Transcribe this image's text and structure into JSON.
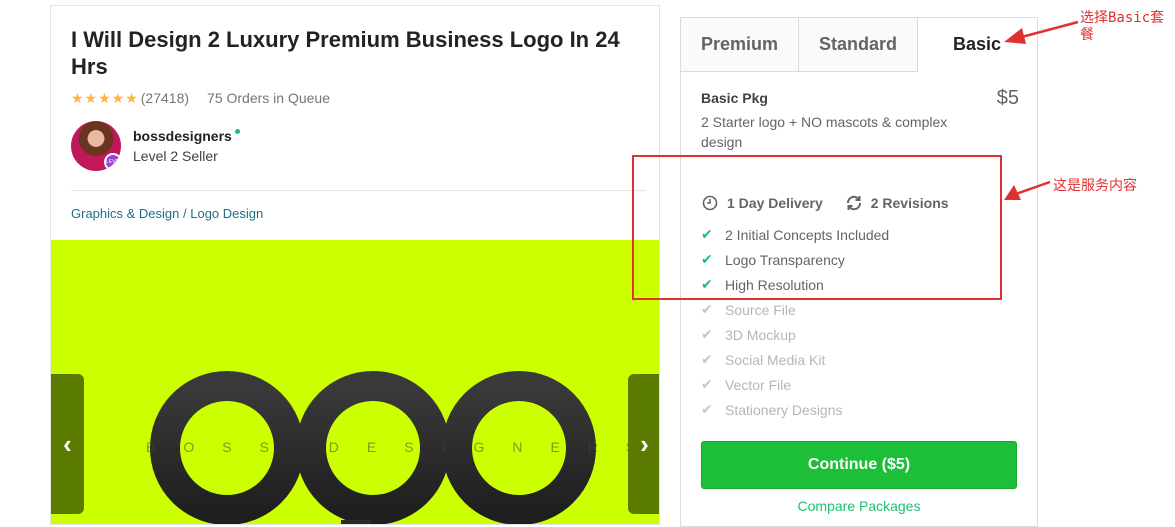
{
  "gig": {
    "title": "I Will Design 2 Luxury Premium Business Logo In 24 Hrs",
    "stars": "★★★★★",
    "rating_count": "(27418)",
    "orders_in_queue": "75 Orders in Queue",
    "seller": {
      "name": "bossdesigners",
      "level": "Level 2 Seller",
      "badge": "LEVEL TWO"
    },
    "breadcrumb": [
      "Graphics & Design",
      "Logo Design"
    ],
    "breadcrumb_sep": " / ",
    "gallery": {
      "logo_text": "logo",
      "watermark": "BOSS DESIGNERS",
      "prev_label": "‹",
      "next_label": "›",
      "background": "#ccff00"
    }
  },
  "packages": {
    "tabs": [
      {
        "label": "Premium",
        "active": false
      },
      {
        "label": "Standard",
        "active": false
      },
      {
        "label": "Basic",
        "active": true
      }
    ],
    "selected": {
      "name": "Basic Pkg",
      "price": "$5",
      "description": "2 Starter logo + NO mascots & complex design",
      "delivery": "1 Day Delivery",
      "revisions": "2 Revisions",
      "features": [
        {
          "label": "2 Initial Concepts Included",
          "included": true
        },
        {
          "label": "Logo Transparency",
          "included": true
        },
        {
          "label": "High Resolution",
          "included": true
        },
        {
          "label": "Source File",
          "included": false
        },
        {
          "label": "3D Mockup",
          "included": false
        },
        {
          "label": "Social Media Kit",
          "included": false
        },
        {
          "label": "Vector File",
          "included": false
        },
        {
          "label": "Stationery Designs",
          "included": false
        }
      ]
    },
    "continue_label": "Continue ($5)",
    "compare_label": "Compare Packages"
  },
  "annotations": {
    "select_basic": "选择Basic套餐",
    "service_content": "这是服务内容"
  },
  "colors": {
    "accent_green": "#1dbf73",
    "button_green": "#1dbf39",
    "annotation_red": "#e03131",
    "star": "#ffb33e"
  }
}
